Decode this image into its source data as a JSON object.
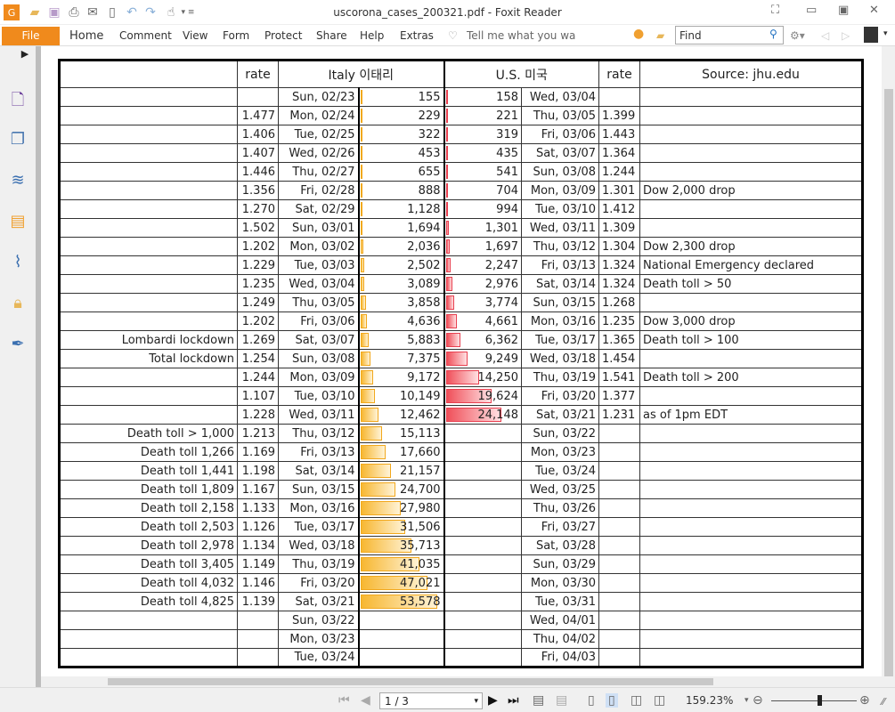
{
  "window": {
    "title": "uscorona_cases_200321.pdf - Foxit Reader"
  },
  "ribbon": {
    "file": "File",
    "tabs": [
      "Home",
      "Comment",
      "View",
      "Form",
      "Protect",
      "Share",
      "Help",
      "Extras"
    ],
    "tell_me": "Tell me what you wa",
    "find_placeholder": "Find"
  },
  "status": {
    "page": "1 / 3",
    "zoom": "159.23%",
    "zoom_slider_fraction": 0.6
  },
  "colors": {
    "accent": "#f08a1c",
    "italy_bar": "#f7b731",
    "us_bar": "#f0505a"
  },
  "table": {
    "headers": {
      "left": "",
      "rate_italy": "rate",
      "italy": "Italy 이태리",
      "us": "U.S. 미국",
      "rate_us": "rate",
      "source": "Source: jhu.edu"
    },
    "left_notes": [
      "",
      "",
      "",
      "",
      "",
      "",
      "",
      "",
      "",
      "",
      "",
      "",
      "",
      "Lombardi lockdown",
      "Total lockdown",
      "",
      "",
      "",
      "Death toll > 1,000",
      "Death toll 1,266",
      "Death toll 1,441",
      "Death toll 1,809",
      "Death toll 2,158",
      "Death toll 2,503",
      "Death toll 2,978",
      "Death toll 3,405",
      "Death toll 4,032",
      "Death toll 4,825",
      "",
      "",
      ""
    ],
    "italy_rates": [
      "",
      "1.477",
      "1.406",
      "1.407",
      "1.446",
      "1.356",
      "1.270",
      "1.502",
      "1.202",
      "1.229",
      "1.235",
      "1.249",
      "1.202",
      "1.269",
      "1.254",
      "1.244",
      "1.107",
      "1.228",
      "1.213",
      "1.169",
      "1.198",
      "1.167",
      "1.133",
      "1.126",
      "1.134",
      "1.149",
      "1.146",
      "1.139",
      "",
      "",
      ""
    ],
    "italy_dates": [
      "Sun, 02/23",
      "Mon, 02/24",
      "Tue, 02/25",
      "Wed, 02/26",
      "Thu, 02/27",
      "Fri, 02/28",
      "Sat, 02/29",
      "Sun, 03/01",
      "Mon, 03/02",
      "Tue, 03/03",
      "Wed, 03/04",
      "Thu, 03/05",
      "Fri, 03/06",
      "Sat, 03/07",
      "Sun, 03/08",
      "Mon, 03/09",
      "Tue, 03/10",
      "Wed, 03/11",
      "Thu, 03/12",
      "Fri, 03/13",
      "Sat, 03/14",
      "Sun, 03/15",
      "Mon, 03/16",
      "Tue, 03/17",
      "Wed, 03/18",
      "Thu, 03/19",
      "Fri, 03/20",
      "Sat, 03/21",
      "Sun, 03/22",
      "Mon, 03/23",
      "Tue, 03/24"
    ],
    "italy_cases": [
      155,
      229,
      322,
      453,
      655,
      888,
      1128,
      1694,
      2036,
      2502,
      3089,
      3858,
      4636,
      5883,
      7375,
      9172,
      10149,
      12462,
      15113,
      17660,
      21157,
      24700,
      27980,
      31506,
      35713,
      41035,
      47021,
      53578
    ],
    "us_cases": [
      158,
      221,
      319,
      435,
      541,
      704,
      994,
      1301,
      1697,
      2247,
      2976,
      3774,
      4661,
      6362,
      9249,
      14250,
      19624,
      24148
    ],
    "us_dates": [
      "Wed, 03/04",
      "Thu, 03/05",
      "Fri, 03/06",
      "Sat, 03/07",
      "Sun, 03/08",
      "Mon, 03/09",
      "Tue, 03/10",
      "Wed, 03/11",
      "Thu, 03/12",
      "Fri, 03/13",
      "Sat, 03/14",
      "Sun, 03/15",
      "Mon, 03/16",
      "Tue, 03/17",
      "Wed, 03/18",
      "Thu, 03/19",
      "Fri, 03/20",
      "Sat, 03/21",
      "Sun, 03/22",
      "Mon, 03/23",
      "Tue, 03/24",
      "Wed, 03/25",
      "Thu, 03/26",
      "Fri, 03/27",
      "Sat, 03/28",
      "Sun, 03/29",
      "Mon, 03/30",
      "Tue, 03/31",
      "Wed, 04/01",
      "Thu, 04/02",
      "Fri, 04/03"
    ],
    "us_rates": [
      "",
      "1.399",
      "1.443",
      "1.364",
      "1.244",
      "1.301",
      "1.412",
      "1.309",
      "1.304",
      "1.324",
      "1.324",
      "1.268",
      "1.235",
      "1.365",
      "1.454",
      "1.541",
      "1.377",
      "1.231",
      "",
      "",
      "",
      "",
      "",
      "",
      "",
      "",
      "",
      "",
      "",
      "",
      ""
    ],
    "source_notes": [
      "",
      "",
      "",
      "",
      "",
      "Dow 2,000 drop",
      "",
      "",
      "Dow 2,300 drop",
      "National Emergency declared",
      "Death toll > 50",
      "",
      "Dow 3,000 drop",
      "Death toll > 100",
      "",
      "Death toll > 200",
      "",
      "as of 1pm EDT",
      "",
      "",
      "",
      "",
      "",
      "",
      "",
      "",
      "",
      "",
      "",
      "",
      ""
    ]
  }
}
